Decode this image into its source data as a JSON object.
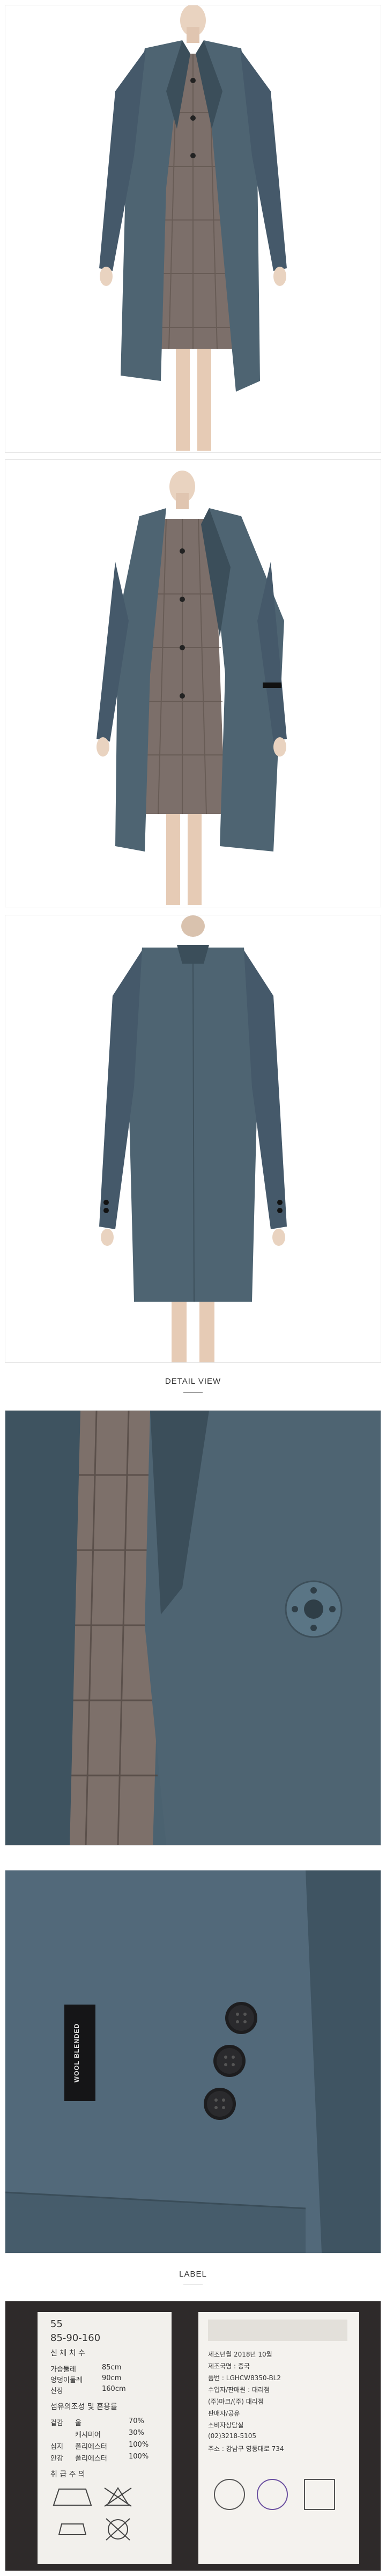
{
  "sections": {
    "detail_title": "DETAIL VIEW",
    "label_title": "LABEL"
  },
  "sleeve_tag_text": "WOOL BLENDED",
  "label_card": {
    "size_top": "55",
    "size_line": "85-90-160",
    "size_header": "신 체 치 수",
    "measurements": [
      {
        "name": "가슴둘레",
        "value": "85cm"
      },
      {
        "name": "엉덩이둘레",
        "value": "90cm"
      },
      {
        "name": "신장",
        "value": "160cm"
      }
    ],
    "fabric_header": "섬유의조성 및 혼용률",
    "fabric": [
      {
        "part": "겉감",
        "material": "울",
        "pct": "70%"
      },
      {
        "part": "",
        "material": "캐시미어",
        "pct": "30%"
      },
      {
        "part": "심지",
        "material": "폴리에스터",
        "pct": "100%"
      },
      {
        "part": "안감",
        "material": "폴리에스터",
        "pct": "100%"
      }
    ],
    "care_header": "취 급 주 의"
  },
  "info_card": {
    "lines": [
      "제조년월 2018년 10월",
      "제조국명 : 중국",
      "품번 : LGHCW8350-BL2",
      "수입자/판매원 : 대리점",
      "(주)마크/(주) 대리점",
      "판매자/공유",
      "소비자상담실",
      "(02)3218-5105",
      "주소 : 강남구 영동대로 734"
    ]
  },
  "colors": {
    "coat": "#4e6472",
    "coat_dark": "#3b4e5a",
    "plaid": "#7c6f6a",
    "skin": "#e9d3c0"
  }
}
